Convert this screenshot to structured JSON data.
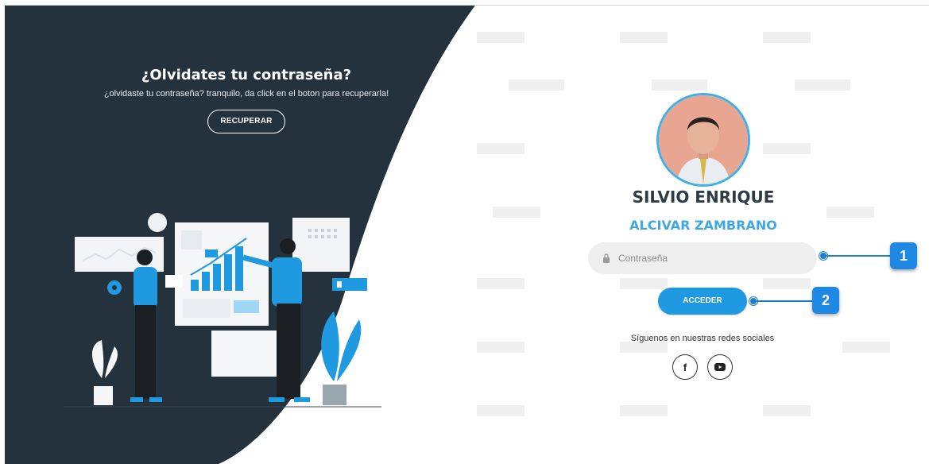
{
  "left": {
    "title": "¿Olvidates tu contraseña?",
    "description": "¿olvidaste tu contraseña? tranquilo, da click en el boton para recuperarla!",
    "recover_label": "RECUPERAR"
  },
  "profile": {
    "first_name": "SILVIO ENRIQUE",
    "last_name": "ALCIVAR ZAMBRANO"
  },
  "form": {
    "password_placeholder": "Contraseña",
    "login_label": "ACCEDER"
  },
  "social": {
    "follow_text": "Síguenos en nuestras redes sociales",
    "facebook_glyph": "f",
    "youtube_icon": "youtube-icon"
  },
  "annotations": {
    "badge1": "1",
    "badge2": "2"
  },
  "colors": {
    "dark_panel": "#24323d",
    "accent_blue": "#1f9ae0",
    "name_blue": "#3fa8e3",
    "badge_blue": "#1e88e5"
  }
}
